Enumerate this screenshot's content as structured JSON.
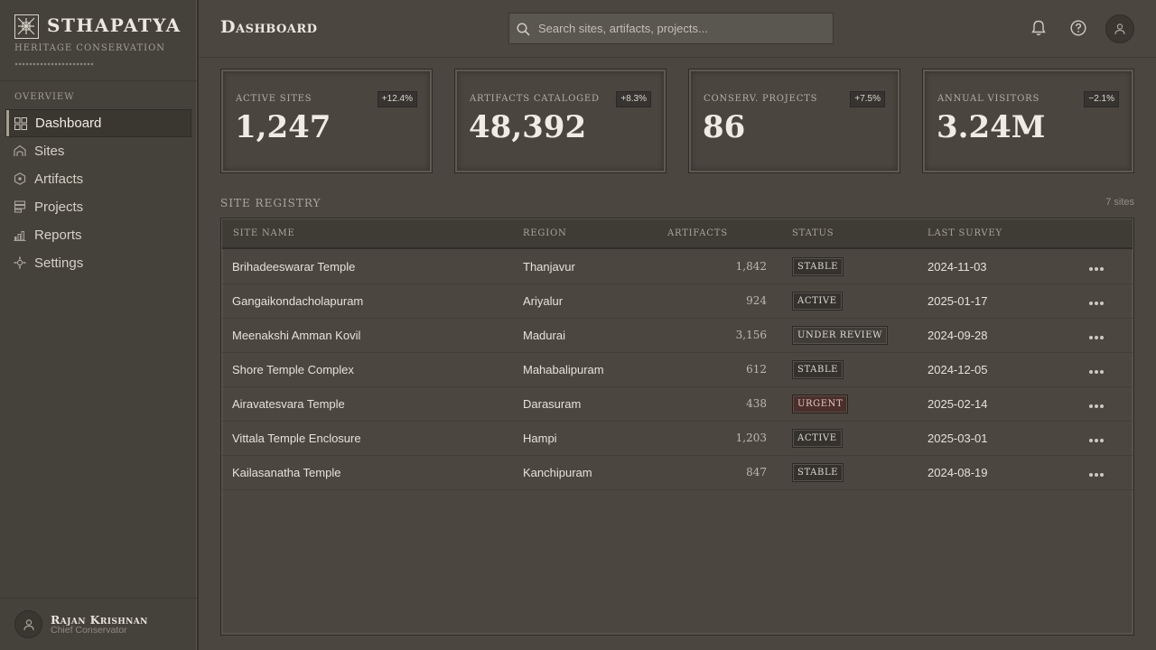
{
  "brand": {
    "name": "STHAPATYA",
    "tagline": "HERITAGE CONSERVATION"
  },
  "nav": {
    "heading": "OVERVIEW",
    "items": [
      {
        "label": "Dashboard",
        "icon": "grid-icon",
        "active": true
      },
      {
        "label": "Sites",
        "icon": "temple-icon",
        "active": false
      },
      {
        "label": "Artifacts",
        "icon": "hexagon-icon",
        "active": false
      },
      {
        "label": "Projects",
        "icon": "stack-icon",
        "active": false
      },
      {
        "label": "Reports",
        "icon": "bar-chart-icon",
        "active": false
      },
      {
        "label": "Settings",
        "icon": "settings-icon",
        "active": false
      }
    ]
  },
  "user": {
    "name": "Rajan Krishnan",
    "role": "Chief Conservator"
  },
  "header": {
    "title": "Dashboard",
    "search_placeholder": "Search sites, artifacts, projects..."
  },
  "stats": [
    {
      "label": "ACTIVE SITES",
      "value": "1,247",
      "change": "+12.4%"
    },
    {
      "label": "ARTIFACTS CATALOGED",
      "value": "48,392",
      "change": "+8.3%"
    },
    {
      "label": "CONSERV. PROJECTS",
      "value": "86",
      "change": "+7.5%"
    },
    {
      "label": "ANNUAL VISITORS",
      "value": "3.24M",
      "change": "−2.1%"
    }
  ],
  "registry": {
    "title": "SITE REGISTRY",
    "count": "7 sites",
    "columns": {
      "name": "SITE NAME",
      "region": "REGION",
      "artifacts": "ARTIFACTS",
      "status": "STATUS",
      "survey": "LAST SURVEY"
    },
    "rows": [
      {
        "name": "Brihadeeswarar Temple",
        "region": "Thanjavur",
        "artifacts": "1,842",
        "status": "STABLE",
        "survey": "2024-11-03"
      },
      {
        "name": "Gangaikondacholapuram",
        "region": "Ariyalur",
        "artifacts": "924",
        "status": "ACTIVE",
        "survey": "2025-01-17"
      },
      {
        "name": "Meenakshi Amman Kovil",
        "region": "Madurai",
        "artifacts": "3,156",
        "status": "UNDER REVIEW",
        "survey": "2024-09-28"
      },
      {
        "name": "Shore Temple Complex",
        "region": "Mahabalipuram",
        "artifacts": "612",
        "status": "STABLE",
        "survey": "2024-12-05"
      },
      {
        "name": "Airavatesvara Temple",
        "region": "Darasuram",
        "artifacts": "438",
        "status": "URGENT",
        "survey": "2025-02-14"
      },
      {
        "name": "Vittala Temple Enclosure",
        "region": "Hampi",
        "artifacts": "1,203",
        "status": "ACTIVE",
        "survey": "2025-03-01"
      },
      {
        "name": "Kailasanatha Temple",
        "region": "Kanchipuram",
        "artifacts": "847",
        "status": "STABLE",
        "survey": "2024-08-19"
      }
    ]
  },
  "colors": {
    "background": "#4b4740",
    "sidebar": "#45423b",
    "urgent": "#4a2f2c"
  }
}
